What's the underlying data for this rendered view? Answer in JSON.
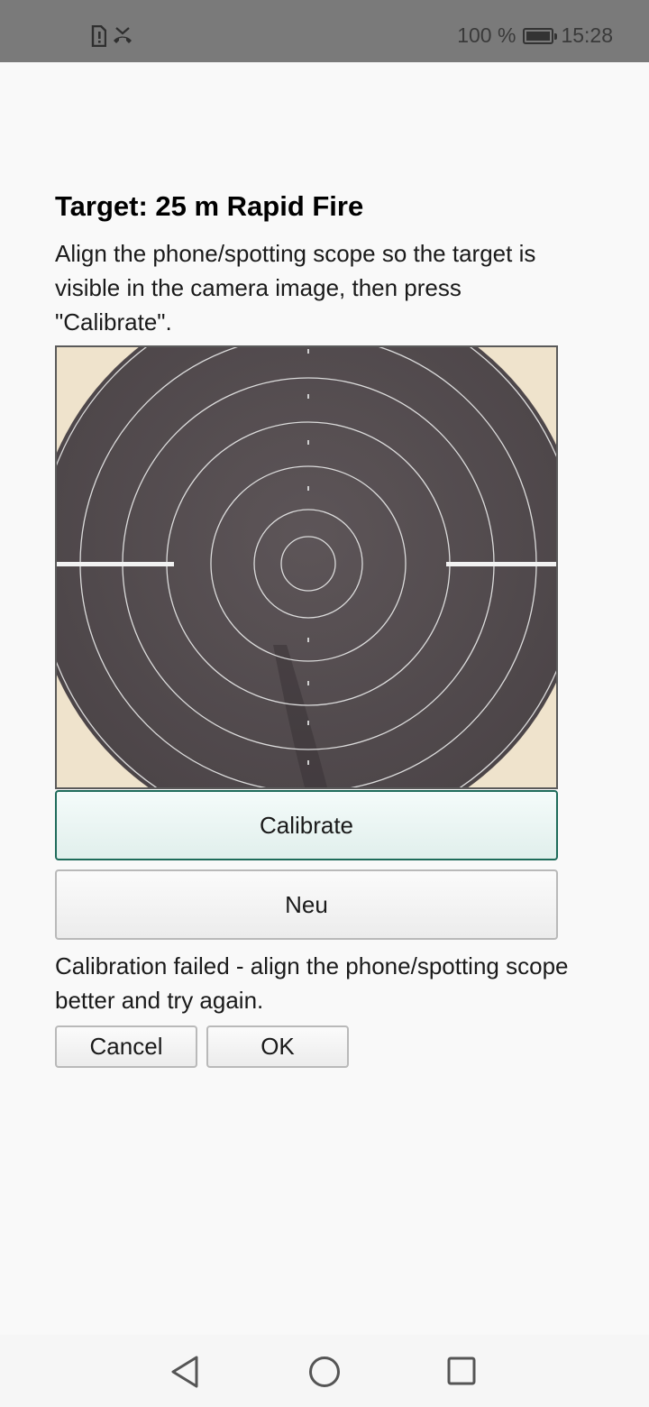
{
  "status_bar": {
    "battery_percent": "100 %",
    "time": "15:28",
    "battery_level": 1.0,
    "left_icons": [
      "sim-alert-icon",
      "missed-call-icon"
    ]
  },
  "screen": {
    "title": "Target: 25 m Rapid Fire",
    "instructions": "Align the phone/spotting scope so the target is visible in the camera image, then press \"Calibrate\".",
    "camera_preview": {
      "description_icon": "target-camera-preview"
    },
    "calibrate_label": "Calibrate",
    "new_label": "Neu",
    "status_message": "Calibration failed - align the phone/spotting scope better and try again.",
    "cancel_label": "Cancel",
    "ok_label": "OK"
  },
  "nav_bar": {
    "icons": [
      "back-icon",
      "home-icon",
      "recents-icon"
    ]
  },
  "colors": {
    "accent_border": "#1e6b5a",
    "status_bar": "#7a7a7a",
    "background": "#f9f9f9"
  }
}
